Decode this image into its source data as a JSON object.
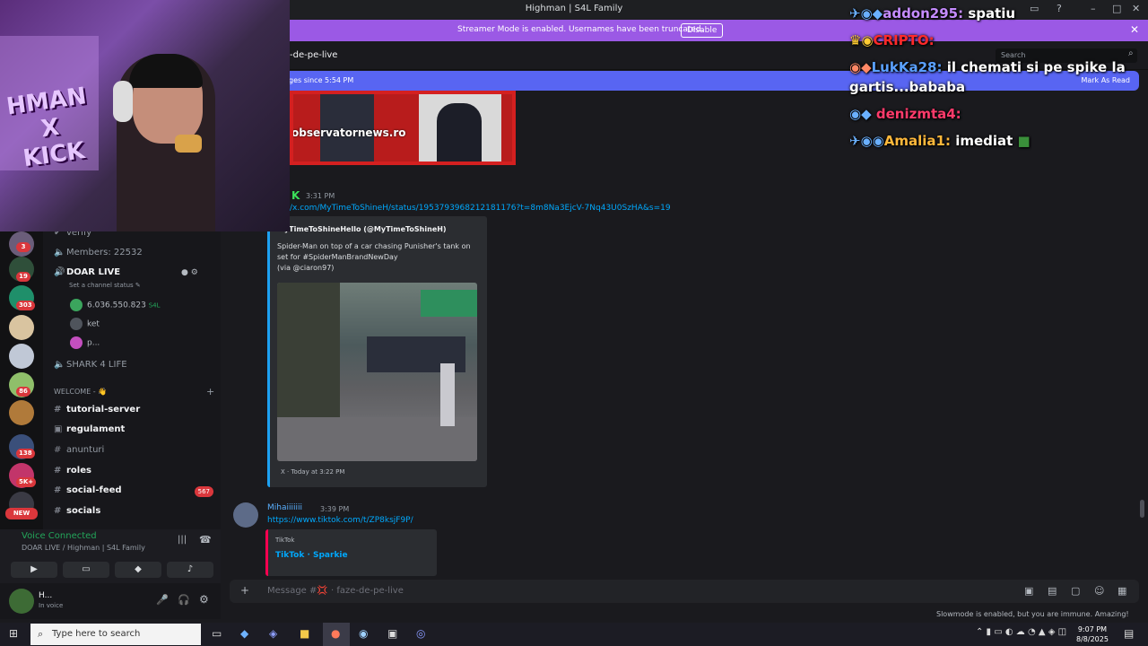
{
  "window": {
    "title": "Highman | S4L Family",
    "controls": [
      "–",
      "□",
      "✕"
    ]
  },
  "banner": {
    "text": "Streamer Mode is enabled. Usernames have been truncated.",
    "button": "Disable",
    "close": "✕"
  },
  "channel_header": {
    "name": "-de-pe-live",
    "search_placeholder": "Search"
  },
  "new_messages": {
    "left": "ges since 5:54 PM",
    "right": "Mark As Read"
  },
  "server_badges": [
    "3",
    "19",
    "303",
    "86",
    "138",
    "5K+"
  ],
  "new_badge": "NEW",
  "sidebar": {
    "channels": [
      {
        "label": "verify"
      },
      {
        "label": "Members: 22532"
      },
      {
        "label": "DOAR LIVE"
      },
      {
        "label": "Set a channel status ✎"
      },
      {
        "label": "SHARK 4 LIFE"
      },
      {
        "label": "WELCOME - 👋"
      },
      {
        "label": "tutorial-server"
      },
      {
        "label": "regulament"
      },
      {
        "label": "anunturi"
      },
      {
        "label": "roles"
      },
      {
        "label": "social-feed",
        "badge": "567"
      },
      {
        "label": "socials"
      }
    ],
    "voice_users": [
      {
        "name": "6.036.550.823",
        "tag": "S4L"
      },
      {
        "name": "ket"
      },
      {
        "name": "p..."
      }
    ],
    "category_plus": "+"
  },
  "voice": {
    "status": "Voice Connected",
    "channel": "DOAR LIVE / Highman | S4L Family"
  },
  "user": {
    "name": "H...",
    "status": "In voice"
  },
  "chat": {
    "embed1_source": "observatornews.ro",
    "msg1_time": "3:31 PM",
    "msg1_link": "/x.com/MyTimeToShineH/status/1953793968212181176?t=8m8Na3EjcV-7Nq43U0SzHA&s=19",
    "embed2_author": "MyTimeToShineHello (@MyTimeToShineH)",
    "embed2_text": [
      "Spider-Man on top of a car chasing Punisher's tank on",
      "set for #SpiderManBrandNewDay",
      "(via @ciaron97)"
    ],
    "embed2_footer": "X · Today at 3:22 PM",
    "msg2_author": "Mihaiiiiiii",
    "msg2_time": "3:39 PM",
    "msg2_link": "https://www.tiktok.com/t/ZP8ksjF9P/",
    "embed3_site": "TikTok",
    "embed3_title": "TikTok · Sparkie"
  },
  "composer": {
    "placeholder": "Message #💢 · faze-de-pe-live",
    "plus": "+"
  },
  "slowmode": "Slowmode is enabled, but you are immune. Amazing!",
  "overlay_chat": [
    {
      "user": "addon295:",
      "text": "spatiu",
      "color": "#c58cff"
    },
    {
      "user": "CRIPTO:",
      "text": "",
      "color": "#ff2a2a"
    },
    {
      "user": "LukKa28:",
      "text": "il chemati si pe spike la",
      "color": "#5aa0ff"
    },
    {
      "user": "",
      "text": "gartis...bababa",
      "color": "#ffffff"
    },
    {
      "user": "denizmta4:",
      "text": "",
      "color": "#ff3b6b"
    },
    {
      "user": "Amalia1:",
      "text": "imediat",
      "color": "#ffb83b"
    }
  ],
  "cam_text": [
    "HMAN",
    "X",
    "KICK"
  ],
  "taskbar": {
    "search": "Type here to search",
    "time": "9:07 PM",
    "date": "8/8/2025"
  }
}
